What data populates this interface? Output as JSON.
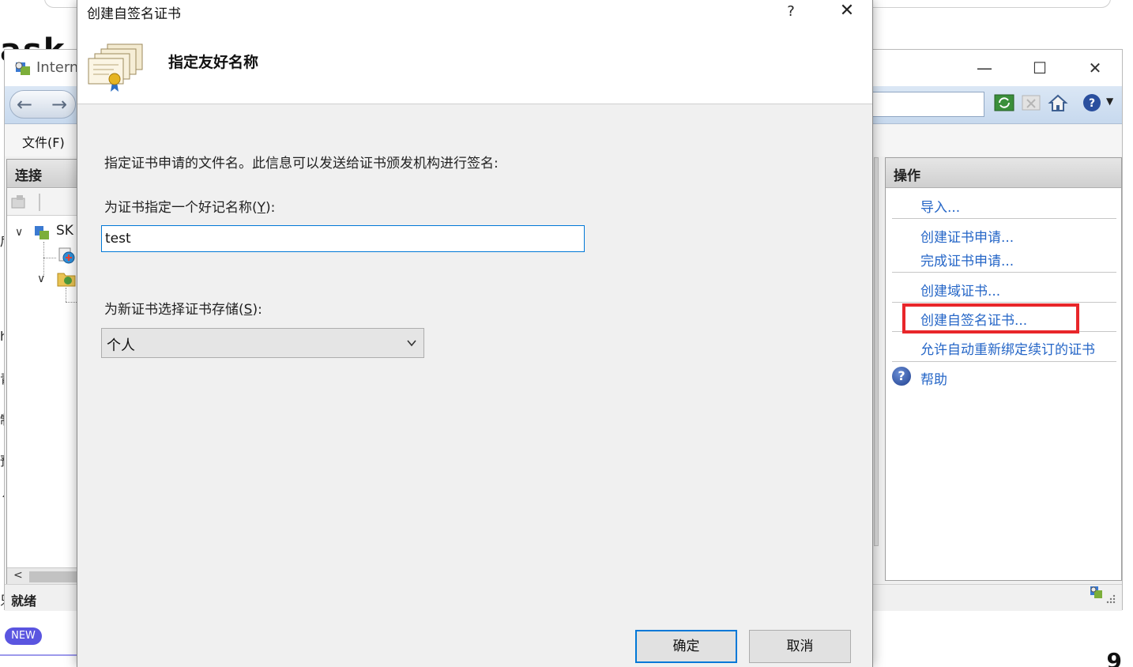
{
  "background": {
    "left_heading_fragment": "ask",
    "edge_fragments": [
      "后",
      "h",
      "青",
      "制",
      "预",
      "↑",
      "只"
    ],
    "new_badge": "NEW",
    "bottom_right_fragment": "9"
  },
  "iis_window": {
    "title": "Intern",
    "menu_file": "文件(F)",
    "connections_header": "连接",
    "tree_root": "SK",
    "status": "就绪",
    "actions_header": "操作",
    "actions": {
      "import": "导入...",
      "create_request": "创建证书申请...",
      "complete_request": "完成证书申请...",
      "create_domain_cert": "创建域证书...",
      "create_self_signed": "创建自签名证书...",
      "auto_rebind": "允许自动重新绑定续订的证书",
      "help": "帮助"
    }
  },
  "dialog": {
    "title": "创建自签名证书",
    "help_button": "?",
    "close_button": "✕",
    "heading": "指定友好名称",
    "description": "指定证书申请的文件名。此信息可以发送给证书颁发机构进行签名:",
    "friendly_name_label_prefix": "为证书指定一个好记名称(",
    "friendly_name_label_key": "Y",
    "friendly_name_label_suffix": "):",
    "friendly_name_value": "test",
    "store_label_prefix": "为新证书选择证书存储(",
    "store_label_key": "S",
    "store_label_suffix": "):",
    "store_selected": "个人",
    "ok_button": "确定",
    "cancel_button": "取消"
  },
  "colors": {
    "accent_blue": "#0078d7",
    "link_blue": "#2566c7",
    "highlight_red": "#e8262a",
    "badge_purple": "#5a55e0"
  }
}
